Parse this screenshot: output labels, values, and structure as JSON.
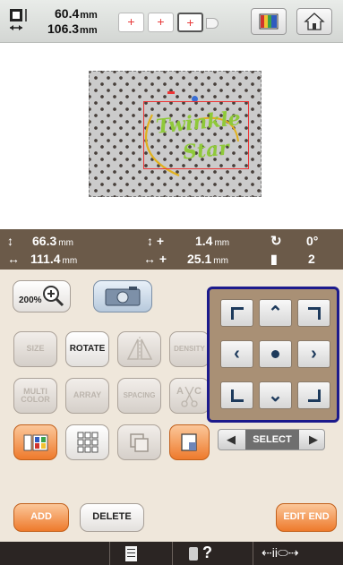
{
  "top": {
    "width": "60.4",
    "height": "106.3",
    "unit": "mm",
    "needles": [
      "+",
      "+",
      "+"
    ]
  },
  "preview": {
    "line1": "Twinkle",
    "line2": "Star"
  },
  "info": {
    "height_val": "66.3",
    "width_val": "111.4",
    "y_offset_sign": "+",
    "y_offset": "1.4",
    "x_offset_sign": "+",
    "x_offset": "25.1",
    "rotation": "0°",
    "thread_count": "2",
    "unit": "mm"
  },
  "zoom": {
    "label": "200%"
  },
  "edit_buttons": {
    "size": "SIZE",
    "rotate": "ROTATE",
    "density": "DENSITY",
    "multi_color": "MULTI\nCOLOR",
    "array": "ARRAY",
    "spacing": "SPACING"
  },
  "select": {
    "label": "SELECT"
  },
  "actions": {
    "add": "ADD",
    "delete": "DELETE",
    "edit_end": "EDIT END"
  },
  "status": {
    "help": "?"
  },
  "colors": {
    "accent": "#ee7a2c",
    "panel_border": "#1c1a8c",
    "design_green": "#8fc93a",
    "info_bg": "#6b5a49"
  }
}
